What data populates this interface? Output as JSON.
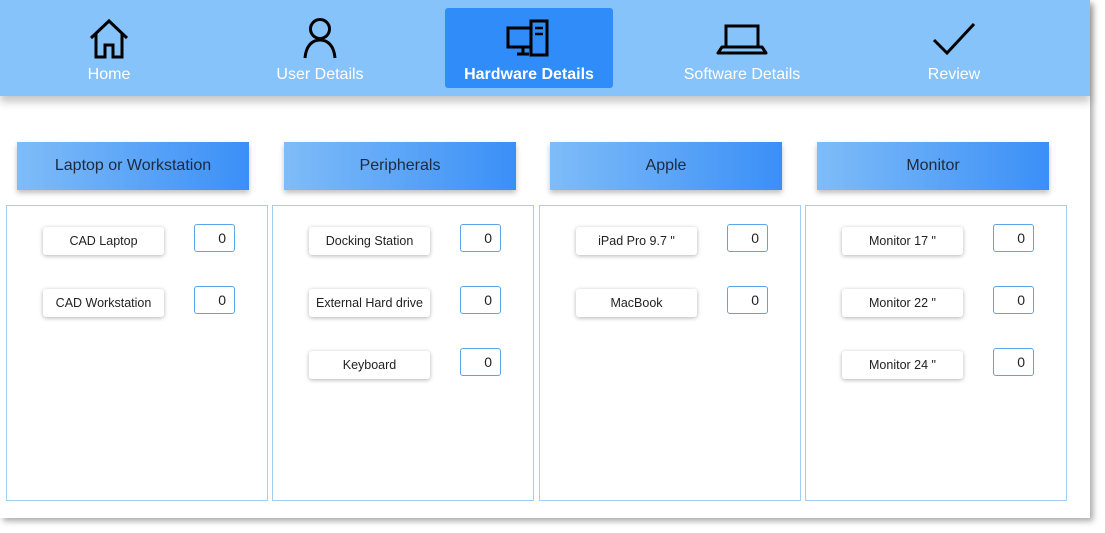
{
  "nav": {
    "items": [
      {
        "label": "Home",
        "icon": "home-icon"
      },
      {
        "label": "User Details",
        "icon": "user-icon"
      },
      {
        "label": "Hardware Details",
        "icon": "hardware-icon",
        "active": true
      },
      {
        "label": "Software Details",
        "icon": "laptop-icon"
      },
      {
        "label": "Review",
        "icon": "checkmark-icon"
      }
    ]
  },
  "categories": [
    {
      "title": "Laptop or Workstation",
      "items": [
        {
          "label": "CAD Laptop",
          "qty": "0"
        },
        {
          "label": "CAD Workstation",
          "qty": "0"
        }
      ]
    },
    {
      "title": "Peripherals",
      "items": [
        {
          "label": "Docking Station",
          "qty": "0"
        },
        {
          "label": "External Hard drive",
          "qty": "0"
        },
        {
          "label": "Keyboard",
          "qty": "0"
        }
      ]
    },
    {
      "title": "Apple",
      "items": [
        {
          "label": "iPad Pro 9.7 \"",
          "qty": "0"
        },
        {
          "label": "MacBook",
          "qty": "0"
        }
      ]
    },
    {
      "title": "Monitor",
      "items": [
        {
          "label": "Monitor 17 \"",
          "qty": "0"
        },
        {
          "label": "Monitor 22 \"",
          "qty": "0"
        },
        {
          "label": "Monitor 24 \"",
          "qty": "0"
        }
      ]
    }
  ],
  "colors": {
    "nav_background": "#86c3fb",
    "nav_active": "#2f8cf8",
    "header_gradient_start": "#7fbcf8",
    "header_gradient_end": "#3a8ff7",
    "panel_border": "#9fd0f4",
    "input_border": "#5aa6ea"
  }
}
